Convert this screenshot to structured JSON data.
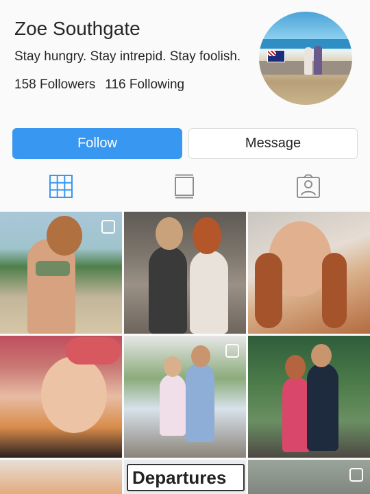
{
  "profile": {
    "name": "Zoe Southgate",
    "bio": "Stay hungry. Stay intrepid. Stay foolish.",
    "followers": "158 Followers",
    "following": "116 Following"
  },
  "actions": {
    "follow_label": "Follow",
    "message_label": "Message"
  },
  "tabs": [
    {
      "icon": "grid-icon"
    },
    {
      "icon": "feed-icon"
    },
    {
      "icon": "tagged-icon"
    }
  ],
  "posts": {
    "departures_sign": "Departures"
  },
  "colors": {
    "accent": "#3897f0",
    "grid_icon_active": "#3897f0",
    "icon_inactive": "#8e8e8e"
  }
}
